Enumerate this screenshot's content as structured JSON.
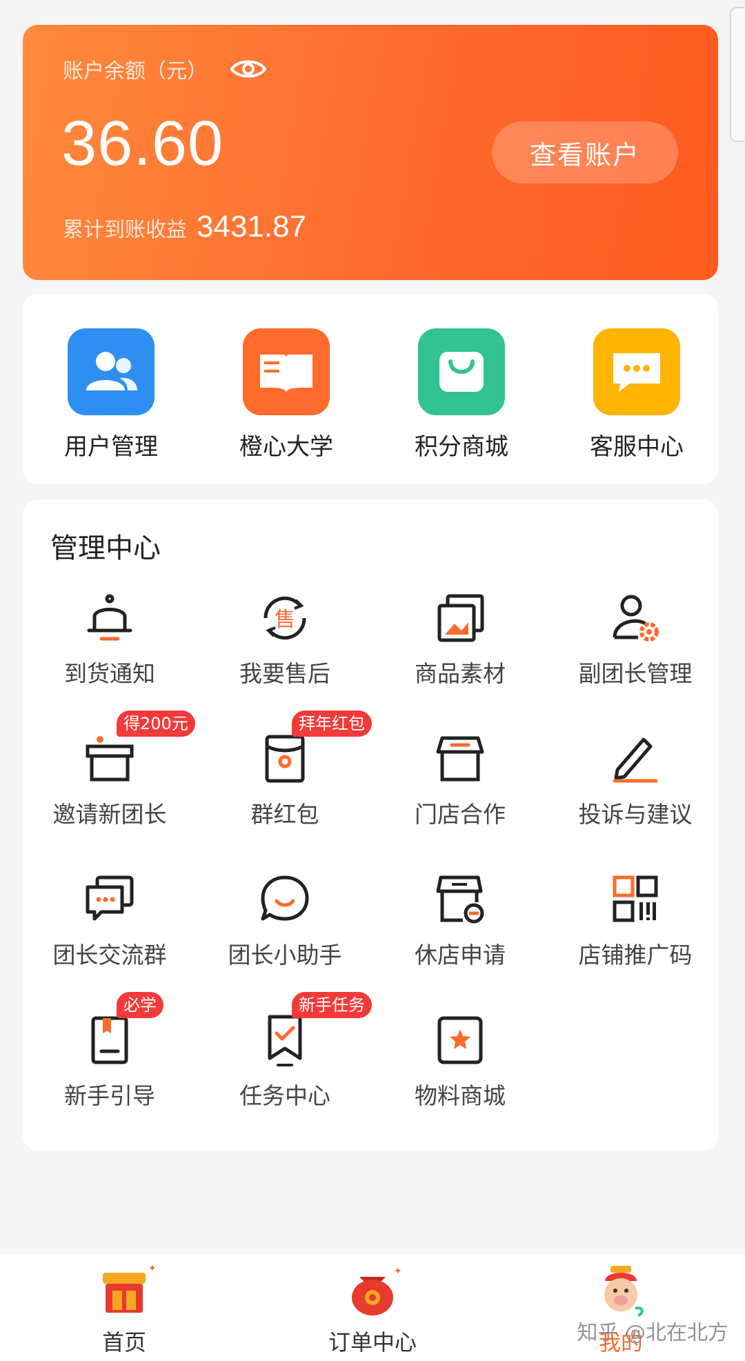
{
  "account": {
    "balance_label": "账户余额（元）",
    "balance": "36.60",
    "view_account": "查看账户",
    "cumulative_label": "累计到账收益",
    "cumulative_value": "3431.87"
  },
  "shortcuts": [
    {
      "label": "用户管理",
      "icon": "users-icon",
      "color": "#2f8ff0"
    },
    {
      "label": "橙心大学",
      "icon": "book-icon",
      "color": "#ff6b2c"
    },
    {
      "label": "积分商城",
      "icon": "shopping-bag-icon",
      "color": "#33c291"
    },
    {
      "label": "客服中心",
      "icon": "chat-icon",
      "color": "#ffb400"
    }
  ],
  "management": {
    "title": "管理中心",
    "items": [
      {
        "label": "到货通知",
        "icon": "bell-icon"
      },
      {
        "label": "我要售后",
        "icon": "after-sale-icon",
        "glyph": "售"
      },
      {
        "label": "商品素材",
        "icon": "gallery-icon"
      },
      {
        "label": "副团长管理",
        "icon": "user-gear-icon"
      },
      {
        "label": "邀请新团长",
        "icon": "gift-box-icon",
        "badge": "得200元"
      },
      {
        "label": "群红包",
        "icon": "red-envelope-icon",
        "badge": "拜年红包"
      },
      {
        "label": "门店合作",
        "icon": "store-icon"
      },
      {
        "label": "投诉与建议",
        "icon": "pen-icon"
      },
      {
        "label": "团长交流群",
        "icon": "group-chat-icon"
      },
      {
        "label": "团长小助手",
        "icon": "assistant-chat-icon"
      },
      {
        "label": "休店申请",
        "icon": "store-closed-icon"
      },
      {
        "label": "店铺推广码",
        "icon": "qr-code-icon"
      },
      {
        "label": "新手引导",
        "icon": "guide-book-icon",
        "badge": "必学"
      },
      {
        "label": "任务中心",
        "icon": "task-bookmark-icon",
        "badge": "新手任务"
      },
      {
        "label": "物料商城",
        "icon": "star-box-icon"
      }
    ]
  },
  "nav": [
    {
      "label": "首页",
      "icon": "home-shop-icon"
    },
    {
      "label": "订单中心",
      "icon": "order-bag-icon"
    },
    {
      "label": "我的",
      "icon": "mascot-avatar-icon",
      "active": true
    }
  ],
  "watermark": "知乎 @北在北方",
  "colors": {
    "accent": "#ff6a2d",
    "badge": "#f23a3a"
  }
}
